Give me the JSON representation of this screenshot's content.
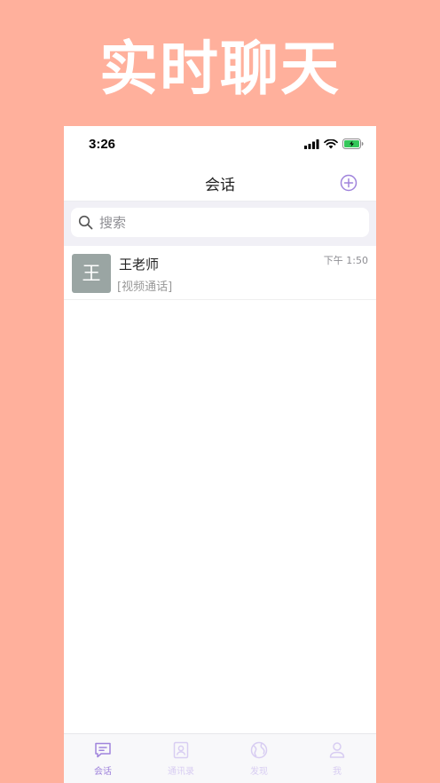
{
  "promo": {
    "title": "实时聊天"
  },
  "status_bar": {
    "time": "3:26"
  },
  "nav": {
    "title": "会话",
    "add_icon": "plus-circle-icon"
  },
  "search": {
    "placeholder": "搜索",
    "value": ""
  },
  "conversations": [
    {
      "avatar_text": "王",
      "name": "王老师",
      "time": "下午 1:50",
      "preview": "[视频通话]"
    }
  ],
  "tabs": [
    {
      "label": "会话",
      "icon": "chat-bubble-icon",
      "active": true
    },
    {
      "label": "通讯录",
      "icon": "contacts-icon",
      "active": false
    },
    {
      "label": "发现",
      "icon": "globe-icon",
      "active": false
    },
    {
      "label": "我",
      "icon": "person-icon",
      "active": false
    }
  ],
  "colors": {
    "background": "#ffb09c",
    "accent": "#a084dc",
    "tab_active": "#a084dc",
    "tab_inactive": "#d8cdf2",
    "avatar": "#9aa5a3",
    "battery": "#34c759"
  }
}
